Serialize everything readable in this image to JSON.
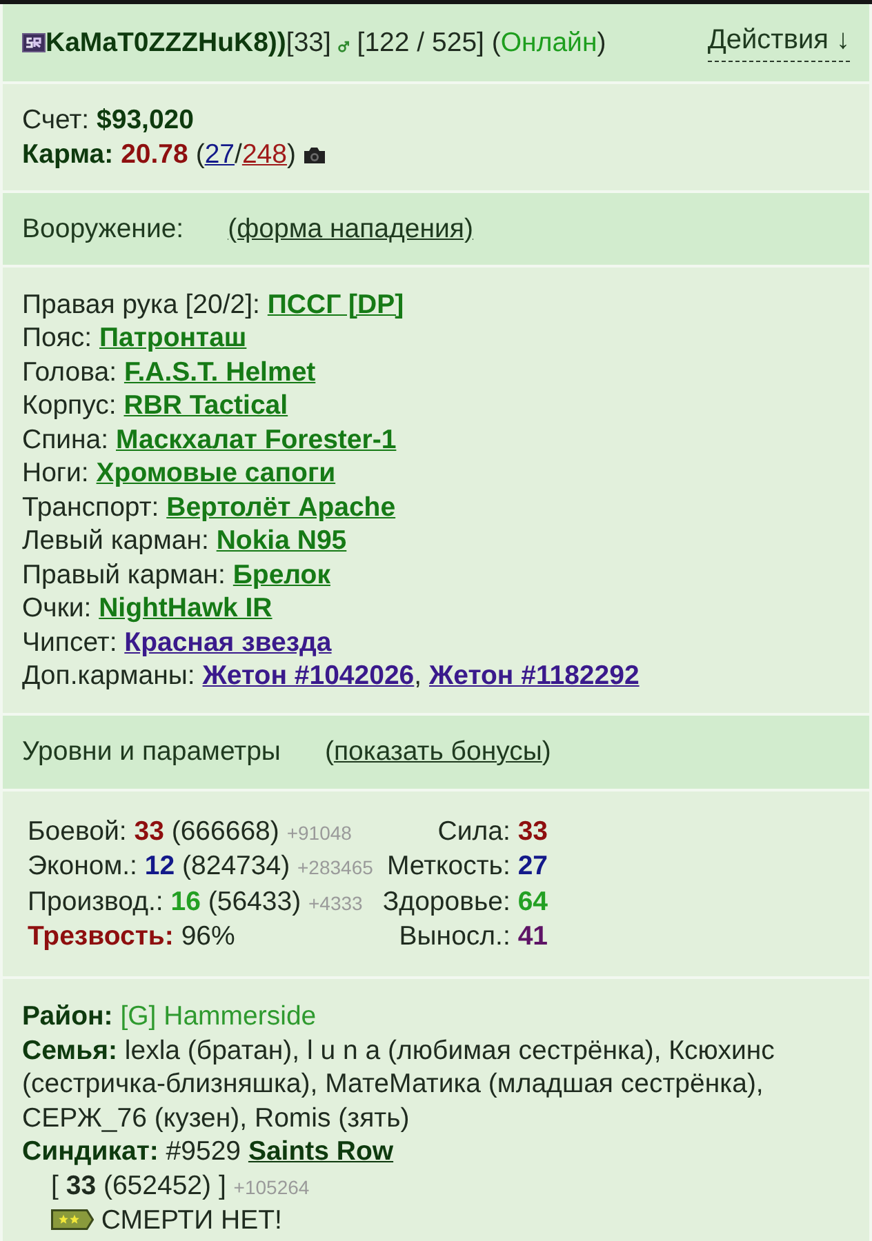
{
  "header": {
    "name": "KaMaT0ZZZHuK8))",
    "level": "[33]",
    "points": "[122 / 525]",
    "status": {
      "open": "(",
      "label": "Онлайн",
      "close": ")",
      "online": true
    },
    "actions": "Действия ↓"
  },
  "account": {
    "score_label": "Счет:",
    "score": "$93,020",
    "karma_label": "Карма:",
    "karma": "20.78",
    "votes_open": "(",
    "votes_up": "27",
    "votes_separator": "/",
    "votes_down": "248",
    "votes_close": ")"
  },
  "equipment_section": {
    "title": "Вооружение:",
    "link": "(форма нападения)"
  },
  "equipment": [
    {
      "slot": "Правая рука [20/2]:",
      "items": [
        {
          "name": "ПССГ [DP]",
          "color": "#167a16"
        }
      ]
    },
    {
      "slot": "Пояс:",
      "items": [
        {
          "name": "Патронташ",
          "color": "#167a16"
        }
      ]
    },
    {
      "slot": "Голова:",
      "items": [
        {
          "name": "F.A.S.T. Helmet",
          "color": "#167a16"
        }
      ]
    },
    {
      "slot": "Корпус:",
      "items": [
        {
          "name": "RBR Tactical",
          "color": "#167a16"
        }
      ]
    },
    {
      "slot": "Спина:",
      "items": [
        {
          "name": "Маскхалат Forester-1",
          "color": "#167a16"
        }
      ]
    },
    {
      "slot": "Ноги:",
      "items": [
        {
          "name": "Хромовые сапоги",
          "color": "#167a16"
        }
      ]
    },
    {
      "slot": "Транспорт:",
      "items": [
        {
          "name": "Вертолёт Apache",
          "color": "#167a16"
        }
      ]
    },
    {
      "slot": "Левый карман:",
      "items": [
        {
          "name": "Nokia N95",
          "color": "#167a16"
        }
      ]
    },
    {
      "slot": "Правый карман:",
      "items": [
        {
          "name": "Брелок",
          "color": "#167a16"
        }
      ]
    },
    {
      "slot": "Очки:",
      "items": [
        {
          "name": "NightHawk IR",
          "color": "#167a16"
        }
      ]
    },
    {
      "slot": "Чипсет:",
      "items": [
        {
          "name": "Красная звезда",
          "color": "#3a1a8c"
        }
      ]
    },
    {
      "slot": "Доп.карманы:",
      "separator": ",",
      "items": [
        {
          "name": "Жетон #1042026",
          "color": "#3a1a8c"
        },
        {
          "name": "Жетон #1182292",
          "color": "#3a1a8c"
        }
      ]
    }
  ],
  "levels_section": {
    "title": "Уровни и параметры",
    "link_open": "(",
    "link": "показать бонусы",
    "link_close": ")"
  },
  "skills": [
    {
      "kind": "skill",
      "label": "Боевой:",
      "level": "33",
      "color": "#8e0f0f",
      "experience": "(666668)",
      "gain": "+91048"
    },
    {
      "kind": "skill",
      "label": "Эконом.:",
      "level": "12",
      "color": "#13198a",
      "experience": "(824734)",
      "gain": "+283465"
    },
    {
      "kind": "skill",
      "label": "Производ.:",
      "level": "16",
      "color": "#23a023",
      "experience": "(56433)",
      "gain": "+4333"
    },
    {
      "kind": "sobriety",
      "label": "Трезвость:",
      "value": "96%"
    }
  ],
  "attributes": [
    {
      "label": "Сила:",
      "value": "33",
      "color": "#8e0f0f"
    },
    {
      "label": "Меткость:",
      "value": "27",
      "color": "#13198a"
    },
    {
      "label": "Здоровье:",
      "value": "64",
      "color": "#23a023"
    },
    {
      "label": "Выносл.:",
      "value": "41",
      "color": "#5e1466"
    }
  ],
  "profile": {
    "district_label": "Район:",
    "district": "[G] Hammerside",
    "family": "**Семья:** lexla (братан), l u n a (любимая сестрёнка), Ксюхинс (сестричка-близняшка), МатеМатика (младшая сестрёнка), СЕРЖ_76 (кузен), Romis (зять)",
    "syndicate_label": "Синдикат:",
    "syndicate_id": "#9529",
    "syndicate": "Saints Row",
    "syndicate_level": "[ **33** (652452) ]",
    "syndicate_gain": "+105264",
    "rank": "СМЕРТИ НЕТ!"
  }
}
